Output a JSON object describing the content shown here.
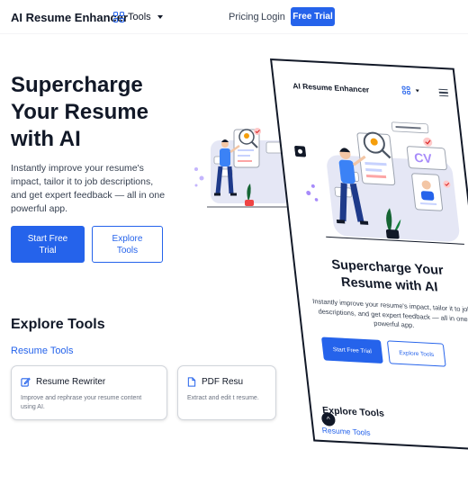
{
  "header": {
    "brand": "AI Resume Enhancer",
    "tools_label": "Tools",
    "pricing": "Pricing",
    "login": "Login",
    "cta": "Free Trial"
  },
  "hero": {
    "title": "Supercharge Your Resume with AI",
    "subtitle": "Instantly improve your resume's impact, tailor it to job descriptions, and get expert feedback — all in one powerful app.",
    "primary_button": "Start Free Trial",
    "secondary_button": "Explore Tools"
  },
  "explore": {
    "title": "Explore Tools",
    "category_link": "Resume Tools",
    "cards": [
      {
        "title": "Resume Rewriter",
        "desc": "Improve and rephrase your resume content using AI.",
        "icon": "pencil-icon"
      },
      {
        "title": "PDF Resu",
        "desc": "Extract and edit t resume.",
        "icon": "document-icon"
      }
    ]
  },
  "mobile": {
    "brand": "AI Resume Enhancer",
    "illustration_badge": "CV",
    "hero_title": "Supercharge Your Resume with AI",
    "hero_subtitle": "Instantly improve your resume's impact, tailor it to job descriptions, and get expert feedback — all in one powerful app.",
    "primary_button": "Start Free Trial",
    "secondary_button": "Explore Tools",
    "explore_title": "Explore Tools",
    "category_link": "Resume Tools",
    "chevron": "^"
  },
  "colors": {
    "accent": "#2563eb",
    "text": "#111827",
    "muted": "#6b7280",
    "card_border": "#d1d5db"
  }
}
